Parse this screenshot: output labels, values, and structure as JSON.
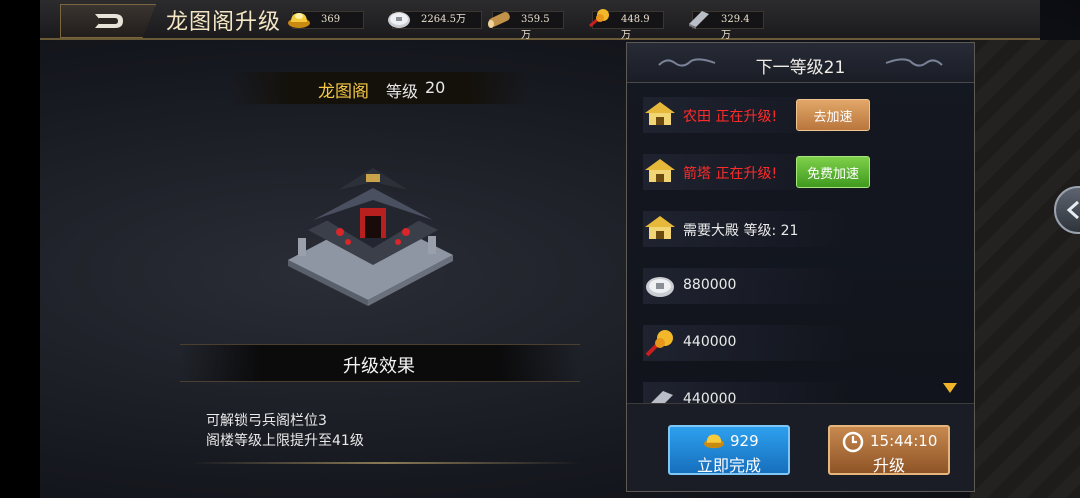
{
  "title": "龙图阁升级",
  "resources": [
    {
      "icon": "gold-ingot-icon",
      "value": "369"
    },
    {
      "icon": "silver-coin-icon",
      "value": "2264.5万"
    },
    {
      "icon": "wood-log-icon",
      "value": "359.5万"
    },
    {
      "icon": "food-grain-icon",
      "value": "448.9万"
    },
    {
      "icon": "iron-bar-icon",
      "value": "329.4万"
    }
  ],
  "building": {
    "name": "龙图阁",
    "level_label": "等级",
    "level_value": "20"
  },
  "effect": {
    "title": "升级效果",
    "lines": [
      "可解锁弓兵阁栏位3",
      "阁楼等级上限提升至41级"
    ]
  },
  "next_level": {
    "title": "下一等级21",
    "requirements": [
      {
        "icon": "building-icon",
        "name": "农田",
        "status": "正在升级!",
        "button": "去加速"
      },
      {
        "icon": "building-icon",
        "name": "箭塔",
        "status": "正在升级!",
        "button": "免费加速"
      },
      {
        "icon": "building-icon",
        "text": "需要大殿 等级:  21"
      },
      {
        "icon": "silver-coin-icon",
        "text": "880000"
      },
      {
        "icon": "food-grain-icon",
        "text": "440000"
      },
      {
        "icon": "iron-bar-icon",
        "text": "440000"
      }
    ]
  },
  "buttons": {
    "finish_cost": "929",
    "finish_label": "立即完成",
    "upgrade_time": "15:44:10",
    "upgrade_label": "升级"
  },
  "colors": {
    "accent_gold": "#f5c844",
    "status_red": "#ff2b2b",
    "finish_blue": "#1f86d6",
    "upgrade_brown": "#b0703a",
    "speed_green": "#5cb533"
  }
}
